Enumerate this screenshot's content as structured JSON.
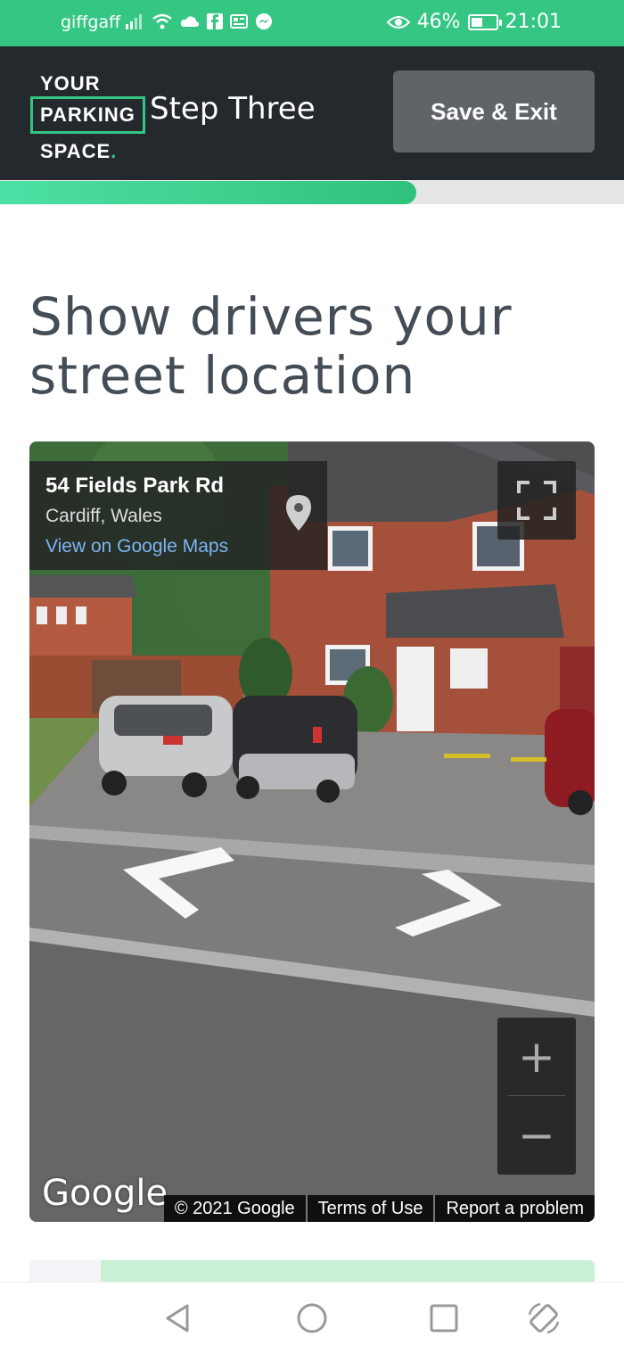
{
  "status_bar": {
    "carrier": "giffgaff",
    "battery_percent": "46%",
    "battery_level": 0.46,
    "time": "21:01"
  },
  "header": {
    "logo": {
      "line1": "YOUR",
      "line2": "PARKING",
      "line3": "SPACE",
      "dot": "."
    },
    "step_title": "Step Three",
    "save_exit_label": "Save & Exit"
  },
  "progress": {
    "fraction": 0.667
  },
  "main": {
    "heading_line1": "Show drivers your",
    "heading_line2": "street location"
  },
  "street_view": {
    "address": "54 Fields Park Rd",
    "city": "Cardiff, Wales",
    "maps_link": "View on Google Maps",
    "zoom_in": "+",
    "zoom_out": "−",
    "google_logo": "Google",
    "copyright": "© 2021 Google",
    "terms": "Terms of Use",
    "report": "Report a problem"
  },
  "colors": {
    "brand_green": "#35c684",
    "header_dark": "#24292e",
    "heading_text": "#444c55"
  }
}
